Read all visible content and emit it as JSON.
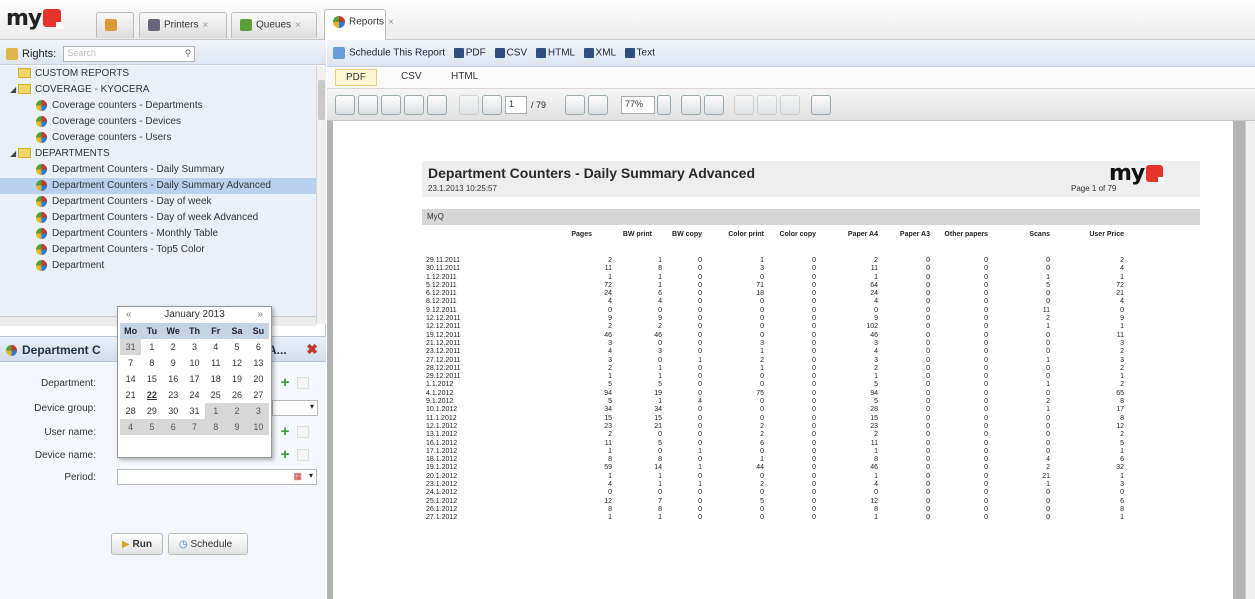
{
  "app": {
    "logo_text": "my"
  },
  "tabs": [
    {
      "label": ""
    },
    {
      "label": "Printers"
    },
    {
      "label": "Queues"
    },
    {
      "label": "Reports"
    }
  ],
  "rights": {
    "label": "Rights:",
    "search_placeholder": "Search"
  },
  "tree": [
    {
      "label": "CUSTOM REPORTS",
      "kind": "folder",
      "expander": ""
    },
    {
      "label": "COVERAGE - KYOCERA",
      "kind": "folder",
      "expander": "◢"
    },
    {
      "label": "Coverage counters - Departments",
      "kind": "report"
    },
    {
      "label": "Coverage counters - Devices",
      "kind": "report"
    },
    {
      "label": "Coverage counters - Users",
      "kind": "report"
    },
    {
      "label": "DEPARTMENTS",
      "kind": "folder",
      "expander": "◢"
    },
    {
      "label": "Department Counters - Daily Summary",
      "kind": "report"
    },
    {
      "label": "Department Counters - Daily Summary Advanced",
      "kind": "report",
      "selected": true
    },
    {
      "label": "Department Counters - Day of week",
      "kind": "report"
    },
    {
      "label": "Department Counters - Day of week Advanced",
      "kind": "report"
    },
    {
      "label": "Department Counters - Monthly Table",
      "kind": "report"
    },
    {
      "label": "Department Counters - Top5 Color",
      "kind": "report"
    },
    {
      "label": "Department",
      "kind": "report"
    }
  ],
  "params": {
    "header": "Department C",
    "header_tail": "A...",
    "department_label": "Department:",
    "device_group_label": "Device group:",
    "user_name_label": "User name:",
    "device_name_label": "Device name:",
    "period_label": "Period:",
    "run_label": "Run",
    "schedule_label": "Schedule"
  },
  "calendar": {
    "month": "January 2013",
    "prev": "«",
    "next": "»",
    "weekdays": [
      "Mo",
      "Tu",
      "We",
      "Th",
      "Fr",
      "Sa",
      "Su"
    ],
    "days": [
      [
        "31",
        "1",
        "2",
        "3",
        "4",
        "5",
        "6"
      ],
      [
        "7",
        "8",
        "9",
        "10",
        "11",
        "12",
        "13"
      ],
      [
        "14",
        "15",
        "16",
        "17",
        "18",
        "19",
        "20"
      ],
      [
        "21",
        "22",
        "23",
        "24",
        "25",
        "26",
        "27"
      ],
      [
        "28",
        "29",
        "30",
        "31",
        "1",
        "2",
        "3"
      ],
      [
        "4",
        "5",
        "6",
        "7",
        "8",
        "9",
        "10"
      ]
    ]
  },
  "report_toolbar": {
    "schedule": "Schedule This Report",
    "pdf": "PDF",
    "csv": "CSV",
    "html": "HTML",
    "xml": "XML",
    "text": "Text"
  },
  "format_tabs": [
    "PDF",
    "CSV",
    "HTML"
  ],
  "pdf_toolbar": {
    "page": "1",
    "page_total": "/ 79",
    "zoom": "77%"
  },
  "report": {
    "title": "Department Counters - Daily Summary Advanced",
    "generated": "23.1.2013 10:25:57",
    "page": "Page 1 of 79",
    "group": "MyQ",
    "logo": "my",
    "columns": [
      "Pages",
      "BW print",
      "BW copy",
      "Color print",
      "Color copy",
      "Paper A4",
      "Paper A3",
      "Other papers",
      "Scans",
      "User Price"
    ],
    "rows": [
      [
        "29.11.2011",
        "2",
        "1",
        "0",
        "1",
        "0",
        "2",
        "0",
        "0",
        "0",
        "2"
      ],
      [
        "30.11.2011",
        "11",
        "8",
        "0",
        "3",
        "0",
        "11",
        "0",
        "0",
        "0",
        "4"
      ],
      [
        "1.12.2011",
        "1",
        "1",
        "0",
        "0",
        "0",
        "1",
        "0",
        "0",
        "1",
        "1"
      ],
      [
        "5.12.2011",
        "72",
        "1",
        "0",
        "71",
        "0",
        "64",
        "0",
        "0",
        "5",
        "72"
      ],
      [
        "6.12.2011",
        "24",
        "6",
        "0",
        "18",
        "0",
        "24",
        "0",
        "0",
        "0",
        "21"
      ],
      [
        "8.12.2011",
        "4",
        "4",
        "0",
        "0",
        "0",
        "4",
        "0",
        "0",
        "0",
        "4"
      ],
      [
        "9.12.2011",
        "0",
        "0",
        "0",
        "0",
        "0",
        "0",
        "0",
        "0",
        "11",
        "0"
      ],
      [
        "12.12.2011",
        "9",
        "9",
        "0",
        "0",
        "0",
        "9",
        "0",
        "0",
        "2",
        "9"
      ],
      [
        "12.12.2011",
        "2",
        "2",
        "0",
        "0",
        "0",
        "102",
        "0",
        "0",
        "1",
        "1"
      ],
      [
        "19.12.2011",
        "46",
        "46",
        "0",
        "0",
        "0",
        "46",
        "0",
        "0",
        "0",
        "11"
      ],
      [
        "21.12.2011",
        "3",
        "0",
        "0",
        "3",
        "0",
        "3",
        "0",
        "0",
        "0",
        "3"
      ],
      [
        "23.12.2011",
        "4",
        "3",
        "0",
        "1",
        "0",
        "4",
        "0",
        "0",
        "0",
        "2"
      ],
      [
        "27.12.2011",
        "3",
        "0",
        "1",
        "2",
        "0",
        "3",
        "0",
        "0",
        "1",
        "3"
      ],
      [
        "28.12.2011",
        "2",
        "1",
        "0",
        "1",
        "0",
        "2",
        "0",
        "0",
        "0",
        "2"
      ],
      [
        "29.12.2011",
        "1",
        "1",
        "0",
        "0",
        "0",
        "1",
        "0",
        "0",
        "0",
        "1"
      ],
      [
        "1.1.2012",
        "5",
        "5",
        "0",
        "0",
        "0",
        "5",
        "0",
        "0",
        "1",
        "2"
      ],
      [
        "4.1.2012",
        "94",
        "19",
        "0",
        "75",
        "0",
        "94",
        "0",
        "0",
        "0",
        "65"
      ],
      [
        "9.1.2012",
        "5",
        "1",
        "4",
        "0",
        "0",
        "5",
        "0",
        "0",
        "2",
        "8"
      ],
      [
        "10.1.2012",
        "34",
        "34",
        "0",
        "0",
        "0",
        "28",
        "0",
        "0",
        "1",
        "17"
      ],
      [
        "11.1.2012",
        "15",
        "15",
        "0",
        "0",
        "0",
        "15",
        "0",
        "0",
        "0",
        "8"
      ],
      [
        "12.1.2012",
        "23",
        "21",
        "0",
        "2",
        "0",
        "23",
        "0",
        "0",
        "0",
        "12"
      ],
      [
        "13.1.2012",
        "2",
        "0",
        "0",
        "2",
        "0",
        "2",
        "0",
        "0",
        "0",
        "2"
      ],
      [
        "16.1.2012",
        "11",
        "5",
        "0",
        "6",
        "0",
        "11",
        "0",
        "0",
        "0",
        "5"
      ],
      [
        "17.1.2012",
        "1",
        "0",
        "1",
        "0",
        "0",
        "1",
        "0",
        "0",
        "0",
        "1"
      ],
      [
        "18.1.2012",
        "8",
        "8",
        "0",
        "1",
        "0",
        "8",
        "0",
        "0",
        "4",
        "6"
      ],
      [
        "19.1.2012",
        "59",
        "14",
        "1",
        "44",
        "0",
        "46",
        "0",
        "0",
        "2",
        "32"
      ],
      [
        "20.1.2012",
        "1",
        "1",
        "0",
        "0",
        "0",
        "1",
        "0",
        "0",
        "21",
        "1"
      ],
      [
        "23.1.2012",
        "4",
        "1",
        "1",
        "2",
        "0",
        "4",
        "0",
        "0",
        "1",
        "3"
      ],
      [
        "24.1.2012",
        "0",
        "0",
        "0",
        "0",
        "0",
        "0",
        "0",
        "0",
        "0",
        "0"
      ],
      [
        "25.1.2012",
        "12",
        "7",
        "0",
        "5",
        "0",
        "12",
        "0",
        "0",
        "0",
        "6"
      ],
      [
        "26.1.2012",
        "8",
        "8",
        "0",
        "0",
        "0",
        "8",
        "0",
        "0",
        "0",
        "8"
      ],
      [
        "27.1.2012",
        "1",
        "1",
        "0",
        "0",
        "0",
        "1",
        "0",
        "0",
        "0",
        "1"
      ]
    ]
  },
  "colors": {
    "accent": "#e4342b",
    "selection": "#b9d1ee",
    "tree_bg": "#eaf0f8"
  }
}
